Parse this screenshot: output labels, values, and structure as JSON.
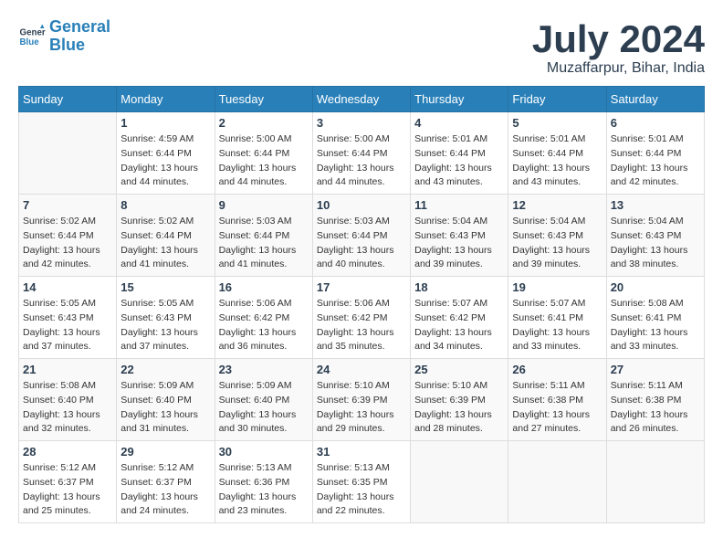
{
  "header": {
    "logo_line1": "General",
    "logo_line2": "Blue",
    "month": "July 2024",
    "location": "Muzaffarpur, Bihar, India"
  },
  "weekdays": [
    "Sunday",
    "Monday",
    "Tuesday",
    "Wednesday",
    "Thursday",
    "Friday",
    "Saturday"
  ],
  "weeks": [
    [
      {
        "day": "",
        "info": ""
      },
      {
        "day": "1",
        "info": "Sunrise: 4:59 AM\nSunset: 6:44 PM\nDaylight: 13 hours\nand 44 minutes."
      },
      {
        "day": "2",
        "info": "Sunrise: 5:00 AM\nSunset: 6:44 PM\nDaylight: 13 hours\nand 44 minutes."
      },
      {
        "day": "3",
        "info": "Sunrise: 5:00 AM\nSunset: 6:44 PM\nDaylight: 13 hours\nand 44 minutes."
      },
      {
        "day": "4",
        "info": "Sunrise: 5:01 AM\nSunset: 6:44 PM\nDaylight: 13 hours\nand 43 minutes."
      },
      {
        "day": "5",
        "info": "Sunrise: 5:01 AM\nSunset: 6:44 PM\nDaylight: 13 hours\nand 43 minutes."
      },
      {
        "day": "6",
        "info": "Sunrise: 5:01 AM\nSunset: 6:44 PM\nDaylight: 13 hours\nand 42 minutes."
      }
    ],
    [
      {
        "day": "7",
        "info": "Sunrise: 5:02 AM\nSunset: 6:44 PM\nDaylight: 13 hours\nand 42 minutes."
      },
      {
        "day": "8",
        "info": "Sunrise: 5:02 AM\nSunset: 6:44 PM\nDaylight: 13 hours\nand 41 minutes."
      },
      {
        "day": "9",
        "info": "Sunrise: 5:03 AM\nSunset: 6:44 PM\nDaylight: 13 hours\nand 41 minutes."
      },
      {
        "day": "10",
        "info": "Sunrise: 5:03 AM\nSunset: 6:44 PM\nDaylight: 13 hours\nand 40 minutes."
      },
      {
        "day": "11",
        "info": "Sunrise: 5:04 AM\nSunset: 6:43 PM\nDaylight: 13 hours\nand 39 minutes."
      },
      {
        "day": "12",
        "info": "Sunrise: 5:04 AM\nSunset: 6:43 PM\nDaylight: 13 hours\nand 39 minutes."
      },
      {
        "day": "13",
        "info": "Sunrise: 5:04 AM\nSunset: 6:43 PM\nDaylight: 13 hours\nand 38 minutes."
      }
    ],
    [
      {
        "day": "14",
        "info": "Sunrise: 5:05 AM\nSunset: 6:43 PM\nDaylight: 13 hours\nand 37 minutes."
      },
      {
        "day": "15",
        "info": "Sunrise: 5:05 AM\nSunset: 6:43 PM\nDaylight: 13 hours\nand 37 minutes."
      },
      {
        "day": "16",
        "info": "Sunrise: 5:06 AM\nSunset: 6:42 PM\nDaylight: 13 hours\nand 36 minutes."
      },
      {
        "day": "17",
        "info": "Sunrise: 5:06 AM\nSunset: 6:42 PM\nDaylight: 13 hours\nand 35 minutes."
      },
      {
        "day": "18",
        "info": "Sunrise: 5:07 AM\nSunset: 6:42 PM\nDaylight: 13 hours\nand 34 minutes."
      },
      {
        "day": "19",
        "info": "Sunrise: 5:07 AM\nSunset: 6:41 PM\nDaylight: 13 hours\nand 33 minutes."
      },
      {
        "day": "20",
        "info": "Sunrise: 5:08 AM\nSunset: 6:41 PM\nDaylight: 13 hours\nand 33 minutes."
      }
    ],
    [
      {
        "day": "21",
        "info": "Sunrise: 5:08 AM\nSunset: 6:40 PM\nDaylight: 13 hours\nand 32 minutes."
      },
      {
        "day": "22",
        "info": "Sunrise: 5:09 AM\nSunset: 6:40 PM\nDaylight: 13 hours\nand 31 minutes."
      },
      {
        "day": "23",
        "info": "Sunrise: 5:09 AM\nSunset: 6:40 PM\nDaylight: 13 hours\nand 30 minutes."
      },
      {
        "day": "24",
        "info": "Sunrise: 5:10 AM\nSunset: 6:39 PM\nDaylight: 13 hours\nand 29 minutes."
      },
      {
        "day": "25",
        "info": "Sunrise: 5:10 AM\nSunset: 6:39 PM\nDaylight: 13 hours\nand 28 minutes."
      },
      {
        "day": "26",
        "info": "Sunrise: 5:11 AM\nSunset: 6:38 PM\nDaylight: 13 hours\nand 27 minutes."
      },
      {
        "day": "27",
        "info": "Sunrise: 5:11 AM\nSunset: 6:38 PM\nDaylight: 13 hours\nand 26 minutes."
      }
    ],
    [
      {
        "day": "28",
        "info": "Sunrise: 5:12 AM\nSunset: 6:37 PM\nDaylight: 13 hours\nand 25 minutes."
      },
      {
        "day": "29",
        "info": "Sunrise: 5:12 AM\nSunset: 6:37 PM\nDaylight: 13 hours\nand 24 minutes."
      },
      {
        "day": "30",
        "info": "Sunrise: 5:13 AM\nSunset: 6:36 PM\nDaylight: 13 hours\nand 23 minutes."
      },
      {
        "day": "31",
        "info": "Sunrise: 5:13 AM\nSunset: 6:35 PM\nDaylight: 13 hours\nand 22 minutes."
      },
      {
        "day": "",
        "info": ""
      },
      {
        "day": "",
        "info": ""
      },
      {
        "day": "",
        "info": ""
      }
    ]
  ]
}
